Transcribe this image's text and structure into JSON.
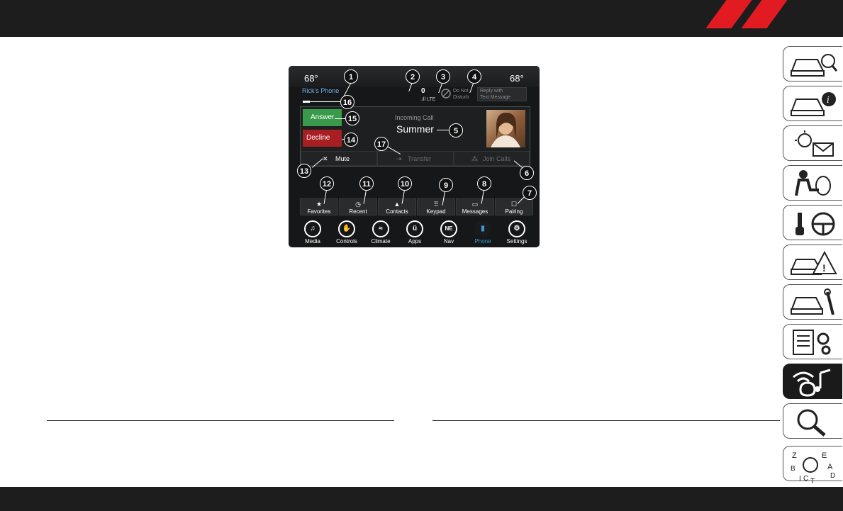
{
  "colors": {
    "brand_red": "#e21b23",
    "header_dark": "#1d1d1d",
    "answer_green": "#3a9a4b",
    "decline_red": "#a71e23",
    "active_blue": "#3b9ad6"
  },
  "screen": {
    "temp_left": "68°",
    "temp_right": "68°",
    "phone_name": "Rick's Phone",
    "signal_count": "0",
    "signal_type": "LTE",
    "dnd_line1": "Do Not",
    "dnd_line2": "Disturb",
    "reply_line1": "Reply with",
    "reply_line2": "Text Message",
    "incoming_label": "Incoming Call",
    "caller_name": "Summer",
    "answer_label": "Answer",
    "decline_label": "Decline",
    "actions": [
      {
        "label": "Mute",
        "icon": "mic-off-icon"
      },
      {
        "label": "Transfer",
        "icon": "transfer-icon"
      },
      {
        "label": "Join Calls",
        "icon": "join-calls-icon"
      }
    ],
    "nav_buttons": [
      {
        "label": "Favorites",
        "icon": "★"
      },
      {
        "label": "Recent",
        "icon": "◷"
      },
      {
        "label": "Contacts",
        "icon": "▲"
      },
      {
        "label": "Keypad",
        "icon": "⠿"
      },
      {
        "label": "Messages",
        "icon": "▭"
      },
      {
        "label": "Pairing",
        "icon": "☐"
      }
    ],
    "dock": [
      {
        "label": "Media",
        "icon": "♫"
      },
      {
        "label": "Controls",
        "icon": "✋"
      },
      {
        "label": "Climate",
        "icon": "≈"
      },
      {
        "label": "Apps",
        "icon": "ü"
      },
      {
        "label": "Nav",
        "icon": "NE"
      },
      {
        "label": "Phone",
        "icon": "▮"
      },
      {
        "label": "Settings",
        "icon": "⚙"
      }
    ]
  },
  "callouts": [
    "1",
    "2",
    "3",
    "4",
    "5",
    "6",
    "7",
    "8",
    "9",
    "10",
    "11",
    "12",
    "13",
    "14",
    "15",
    "16",
    "17"
  ],
  "side_tabs": [
    "car-search-icon",
    "car-info-icon",
    "warning-light-message-icon",
    "airbag-seat-icon",
    "key-steering-icon",
    "car-warning-icon",
    "car-service-icon",
    "list-settings-icon",
    "multimedia-icon",
    "search-icon",
    "index-az-icon"
  ]
}
